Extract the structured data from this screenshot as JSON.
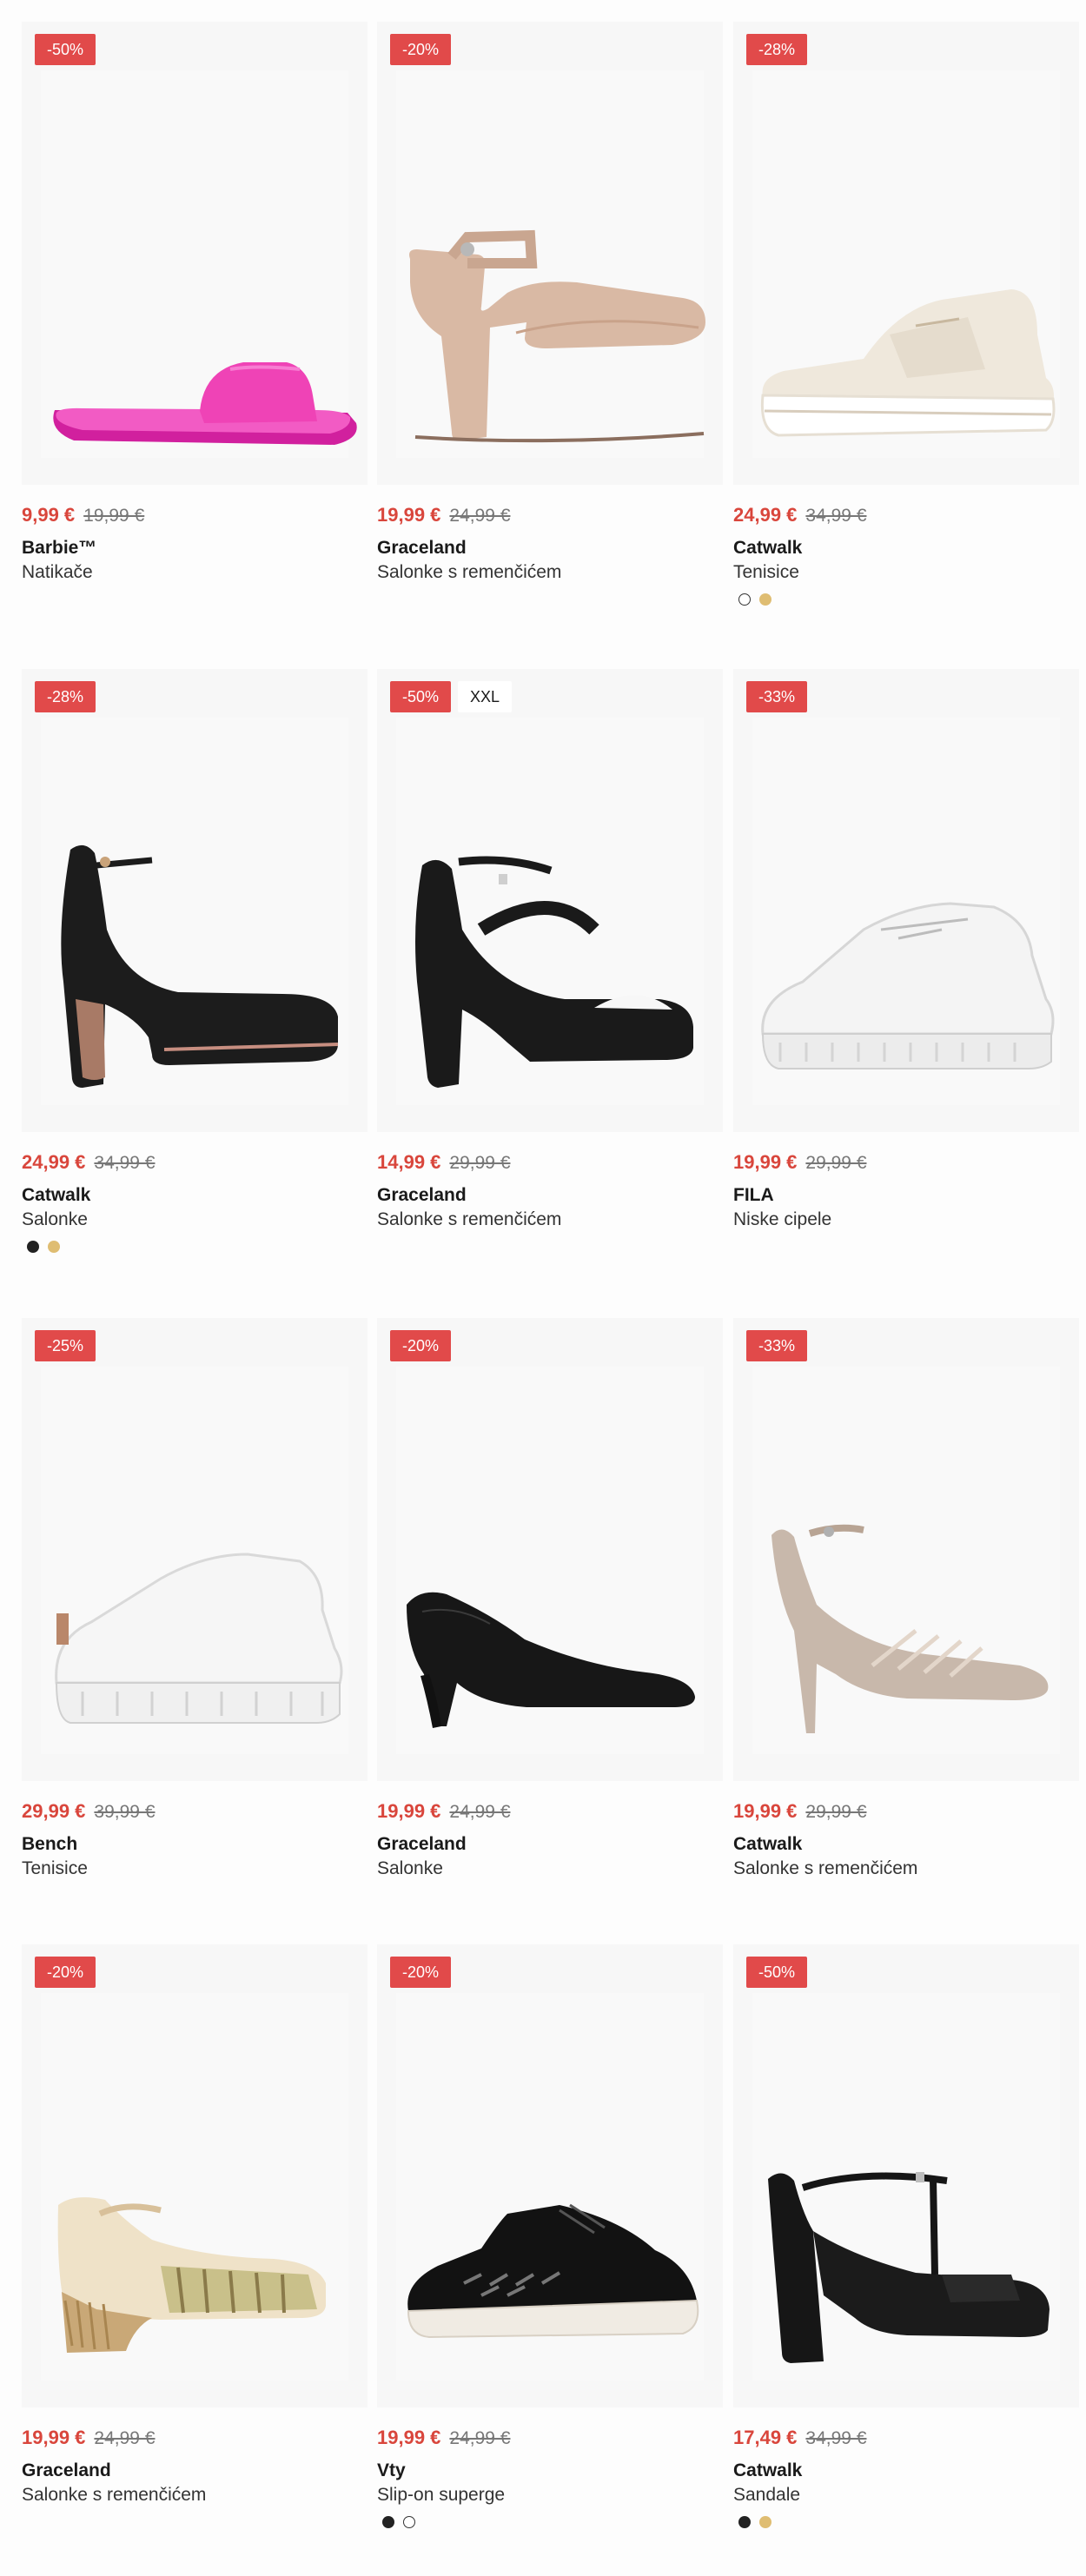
{
  "products": [
    {
      "discount": "-50%",
      "price": "9,99 €",
      "old_price": "19,99 €",
      "brand": "Barbie™",
      "type": "Natikače",
      "swatches": [],
      "icon": "pink-slide-sandal-icon"
    },
    {
      "discount": "-20%",
      "price": "19,99 €",
      "old_price": "24,99 €",
      "brand": "Graceland",
      "type": "Salonke s remenčićem",
      "swatches": [],
      "icon": "beige-block-heel-icon"
    },
    {
      "discount": "-28%",
      "price": "24,99 €",
      "old_price": "34,99 €",
      "brand": "Catwalk",
      "type": "Tenisice",
      "swatches": [
        "white",
        "gold"
      ],
      "icon": "beige-platform-sneaker-icon"
    },
    {
      "discount": "-28%",
      "price": "24,99 €",
      "old_price": "34,99 €",
      "brand": "Catwalk",
      "type": "Salonke",
      "swatches": [
        "black",
        "gold"
      ],
      "icon": "black-platform-heel-icon"
    },
    {
      "discount": "-50%",
      "size_badge": "XXL",
      "price": "14,99 €",
      "old_price": "29,99 €",
      "brand": "Graceland",
      "type": "Salonke s remenčićem",
      "swatches": [],
      "icon": "black-peeptoe-heel-icon"
    },
    {
      "discount": "-33%",
      "price": "19,99 €",
      "old_price": "29,99 €",
      "brand": "FILA",
      "type": "Niske cipele",
      "swatches": [],
      "icon": "white-sneaker-icon"
    },
    {
      "discount": "-25%",
      "price": "29,99 €",
      "old_price": "39,99 €",
      "brand": "Bench",
      "type": "Tenisice",
      "swatches": [],
      "icon": "white-chunky-sneaker-icon"
    },
    {
      "discount": "-20%",
      "price": "19,99 €",
      "old_price": "24,99 €",
      "brand": "Graceland",
      "type": "Salonke",
      "swatches": [],
      "icon": "black-kitten-heel-icon"
    },
    {
      "discount": "-33%",
      "price": "19,99 €",
      "old_price": "29,99 €",
      "brand": "Catwalk",
      "type": "Salonke s remenčićem",
      "swatches": [],
      "icon": "taupe-stiletto-icon"
    },
    {
      "discount": "-20%",
      "price": "19,99 €",
      "old_price": "24,99 €",
      "brand": "Graceland",
      "type": "Salonke s remenčićem",
      "swatches": [],
      "icon": "espadrille-wedge-icon"
    },
    {
      "discount": "-20%",
      "price": "19,99 €",
      "old_price": "24,99 €",
      "brand": "Vty",
      "type": "Slip-on superge",
      "swatches": [
        "black",
        "white"
      ],
      "icon": "black-knit-sneaker-icon"
    },
    {
      "discount": "-50%",
      "price": "17,49 €",
      "old_price": "34,99 €",
      "brand": "Catwalk",
      "type": "Sandale",
      "swatches": [
        "black",
        "gold"
      ],
      "icon": "black-tstrap-sandal-icon"
    }
  ],
  "colors": {
    "discount_badge": "#e14a4a",
    "sale_price": "#d9463c",
    "old_price": "#777777",
    "image_bg": "#f7f7f7"
  }
}
